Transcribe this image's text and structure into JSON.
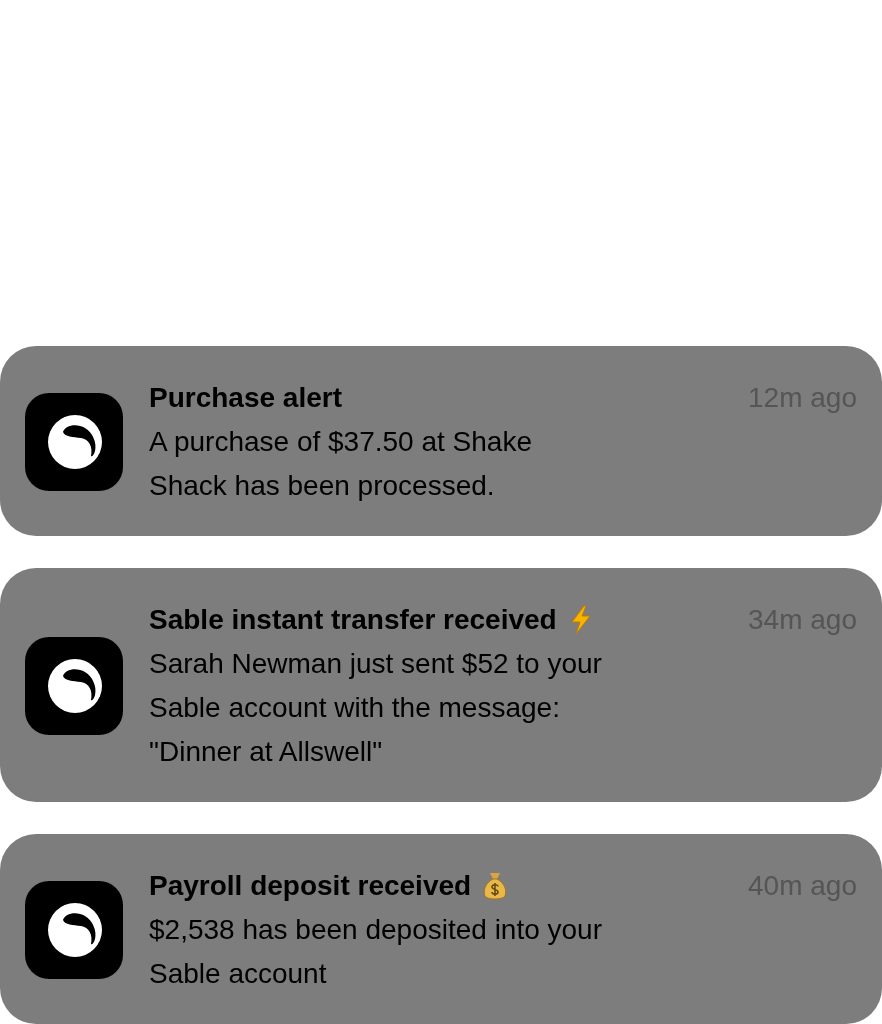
{
  "notifications": [
    {
      "kind": "plain",
      "title": "Purchase alert",
      "time": "12m ago",
      "lines": [
        "A purchase of $37.50 at Shake",
        "Shack has been processed."
      ]
    },
    {
      "kind": "bolt",
      "title": "Sable instant transfer received",
      "time": "34m ago",
      "lines": [
        "Sarah Newman just sent $52 to your",
        "Sable account with the message:",
        "\"Dinner at Allswell\""
      ]
    },
    {
      "kind": "money",
      "title": "Payroll deposit received",
      "time": "40m ago",
      "lines": [
        "$2,538 has been deposited into your",
        "Sable account"
      ]
    }
  ]
}
